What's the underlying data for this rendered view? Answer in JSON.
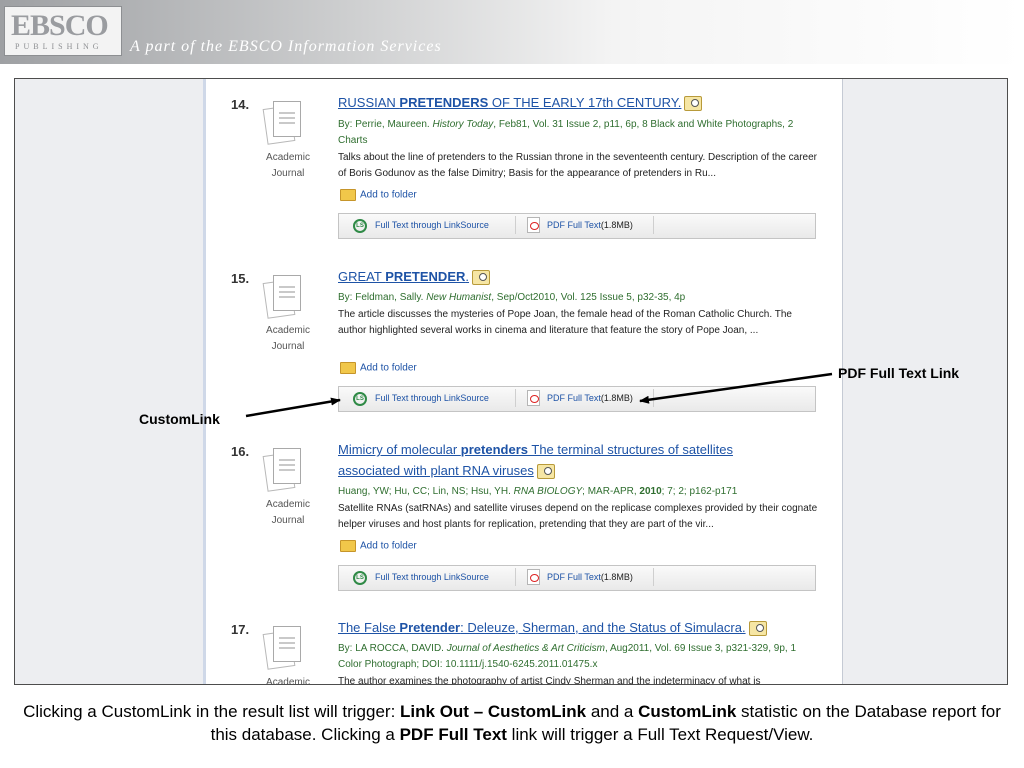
{
  "header": {
    "logo_main": "EBSCO",
    "logo_sub": "PUBLISHING",
    "tagline": "A part of the EBSCO Information Services"
  },
  "results": [
    {
      "number": "14.",
      "type": "Academic Journal",
      "title_pre": "RUSSIAN ",
      "title_bold": "PRETENDERS",
      "title_post": " OF THE EARLY 17th CENTURY.",
      "meta_1": "By: Perrie, Maureen. ",
      "meta_source": "History Today",
      "meta_2": ", Feb81, Vol. 31 Issue 2, p11, 6p, 8 Black and White Photographs, 2 Charts",
      "abstract": "Talks about the line of pretenders to the Russian throne in the seventeenth century. Description of the career of Boris Godunov as the false Dimitry; Basis for the appearance of pretenders in Ru...",
      "folder": "Add to folder",
      "linksource": "Full Text through LinkSource",
      "pdf": "PDF Full Text",
      "pdf_size": "(1.8MB)"
    },
    {
      "number": "15.",
      "type": "Academic Journal",
      "title_pre": "GREAT ",
      "title_bold": "PRETENDER",
      "title_post": ".",
      "meta_1": "By: Feldman, Sally. ",
      "meta_source": "New Humanist",
      "meta_2": ", Sep/Oct2010, Vol. 125 Issue 5, p32-35, 4p",
      "abstract": "The article discusses the mysteries of Pope Joan, the female head of the Roman Catholic Church. The author highlighted several works in cinema and literature that feature the story of Pope Joan, ...",
      "folder": "Add to folder",
      "linksource": "Full Text through LinkSource",
      "pdf": "PDF Full Text",
      "pdf_size": "(1.8MB)"
    },
    {
      "number": "16.",
      "type": "Academic Journal",
      "title_pre": "Mimicry of molecular ",
      "title_bold": "pretenders",
      "title_post": " The terminal structures of satellites",
      "title_line2": "associated with plant RNA viruses",
      "meta_1": "Huang, YW; Hu, CC; Lin, NS; Hsu, YH. ",
      "meta_source": "RNA BIOLOGY",
      "meta_2": "; MAR-APR, ",
      "meta_year": "2010",
      "meta_3": "; 7; 2; p162-p171",
      "abstract": "Satellite RNAs (satRNAs) and satellite viruses depend on the replicase complexes provided by their cognate helper viruses and host plants for replication, pretending that they are part of the vir...",
      "folder": "Add to folder",
      "linksource": "Full Text through LinkSource",
      "pdf": "PDF Full Text",
      "pdf_size": "(1.8MB)"
    },
    {
      "number": "17.",
      "type": "Academic",
      "title_pre": "The False ",
      "title_bold": "Pretender",
      "title_post": ": Deleuze, Sherman, and the Status of Simulacra.",
      "meta_1": "By: LA ROCCA, DAVID. ",
      "meta_source": "Journal of Aesthetics & Art Criticism",
      "meta_2": ", Aug2011, Vol. 69 Issue 3, p321-329, 9p, 1 Color Photograph; DOI: 10.1111/j.1540-6245.2011.01475.x",
      "abstract": "The author examines the photography of artist Cindy Sherman and the indeterminacy of what is"
    }
  ],
  "callouts": {
    "pdf": "PDF Full Text Link",
    "custom": "CustomLink"
  },
  "caption": {
    "p1": "Clicking a CustomLink in the result list will trigger: ",
    "b1": "Link Out – CustomLink",
    "p2": " and a ",
    "b2": "CustomLink",
    "p3": " statistic on the Database report for this database. Clicking a ",
    "b3": "PDF Full Text",
    "p4": " link will trigger a Full Text Request/View."
  }
}
